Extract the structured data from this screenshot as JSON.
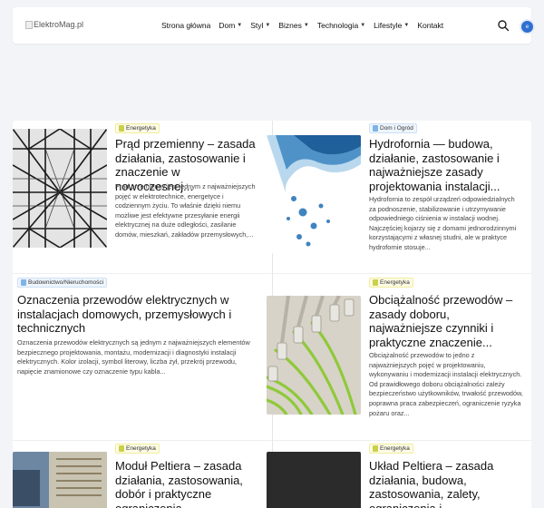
{
  "header": {
    "logo_alt": "ElektroMag.pl",
    "nav": [
      {
        "label": "Strona główna",
        "dropdown": false
      },
      {
        "label": "Dom",
        "dropdown": true
      },
      {
        "label": "Styl",
        "dropdown": true
      },
      {
        "label": "Biznes",
        "dropdown": true
      },
      {
        "label": "Technologia",
        "dropdown": true
      },
      {
        "label": "Lifestyle",
        "dropdown": true
      },
      {
        "label": "Kontakt",
        "dropdown": false
      }
    ],
    "lang_badge": "e"
  },
  "colors": {
    "accent": "#2f6fd1",
    "badge_green": "#c9d14a",
    "badge_blue": "#7fb3e6"
  },
  "articles": [
    {
      "category": "Energetyka",
      "title": "Prąd przemienny – zasada działania, zastosowanie i znaczenie w nowoczesnej...",
      "excerpt": "Prąd przemienny jest jednym z najważniejszych pojęć w elektrotechnice, energetyce i codziennym życiu. To właśnie dzięki niemu możliwe jest efektywne przesyłanie energii elektrycznej na duże odległości, zasilanie domów, mieszkań, zakładów przemysłowych,..."
    },
    {
      "category": "Dom i Ogród",
      "title": "Hydrofornia — budowa, działanie, zastosowanie i najważniejsze zasady projektowania instalacji...",
      "excerpt": "Hydrofornia to zespół urządzeń odpowiedzialnych za podnoszenie, stabilizowanie i utrzymywanie odpowiedniego ciśnienia w instalacji wodnej. Najczęściej kojarzy się z domami jednorodzinnymi korzystającymi z własnej studni, ale w praktyce hydrofornie stosuje..."
    },
    {
      "category": "Budownictwo/Nieruchomości",
      "title": "Oznaczenia przewodów elektrycznych w instalacjach domowych, przemysłowych i technicznych",
      "excerpt": "Oznaczenia przewodów elektrycznych są jednym z najważniejszych elementów bezpiecznego projektowania, montażu, modernizacji i diagnostyki instalacji elektrycznych. Kolor izolacji, symbol literowy, liczba żył, przekrój przewodu, napięcie znamionowe czy oznaczenie typu kabla..."
    },
    {
      "category": "Energetyka",
      "title": "Obciążalność przewodów – zasady doboru, najważniejsze czynniki i praktyczne znaczenie...",
      "excerpt": "Obciążalność przewodów to jedno z najważniejszych pojęć w projektowaniu, wykonywaniu i modernizacji instalacji elektrycznych. Od prawidłowego doboru obciążalności zależy bezpieczeństwo użytkowników, trwałość przewodów, poprawna praca zabezpieczeń, ograniczenie ryzyka pożaru oraz..."
    },
    {
      "category": "Energetyka",
      "title": "Moduł Peltiera – zasada działania, zastosowania, dobór i praktyczne ograniczenia..."
    },
    {
      "category": "Energetyka",
      "title": "Układ Peltiera – zasada działania, budowa, zastosowania, zalety, ograniczenia i..."
    }
  ]
}
